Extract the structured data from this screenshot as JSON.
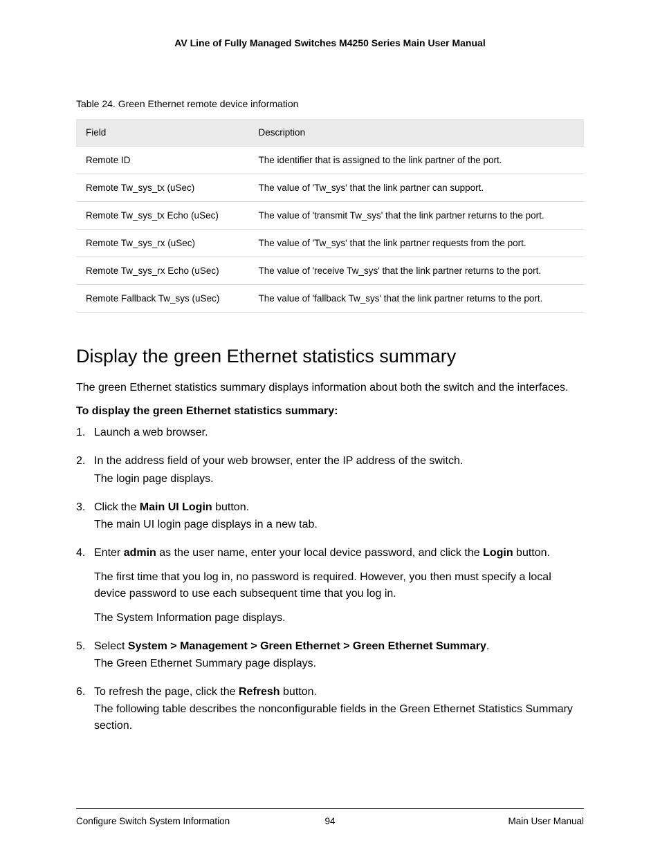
{
  "header": {
    "title": "AV Line of Fully Managed Switches M4250 Series Main User Manual"
  },
  "table": {
    "caption": "Table 24. Green Ethernet remote device information",
    "headers": {
      "col1": "Field",
      "col2": "Description"
    },
    "rows": [
      {
        "field": "Remote ID",
        "desc": "The identifier that is assigned to the link partner of the port."
      },
      {
        "field": "Remote Tw_sys_tx (uSec)",
        "desc": "The value of 'Tw_sys' that the link partner can support."
      },
      {
        "field": "Remote Tw_sys_tx Echo (uSec)",
        "desc": "The value of 'transmit Tw_sys' that the link partner returns to the port."
      },
      {
        "field": "Remote Tw_sys_rx (uSec)",
        "desc": "The value of 'Tw_sys' that the link partner requests from the port."
      },
      {
        "field": "Remote Tw_sys_rx Echo (uSec)",
        "desc": "The value of 'receive Tw_sys' that the link partner returns to the port."
      },
      {
        "field": "Remote Fallback Tw_sys (uSec)",
        "desc": "The value of 'fallback Tw_sys' that the link partner returns to the port."
      }
    ]
  },
  "section": {
    "heading": "Display the green Ethernet statistics summary",
    "intro": "The green Ethernet statistics summary displays information about both the switch and the interfaces.",
    "procedure_head": "To display the green Ethernet statistics summary:",
    "steps": {
      "s1": {
        "main": "Launch a web browser."
      },
      "s2": {
        "main": "In the address field of your web browser, enter the IP address of the switch.",
        "sub": "The login page displays."
      },
      "s3": {
        "pre": "Click the ",
        "bold": "Main UI Login",
        "post": " button.",
        "sub": "The main UI login page displays in a new tab."
      },
      "s4": {
        "pre": "Enter ",
        "bold1": "admin",
        "mid": " as the user name, enter your local device password, and click the ",
        "bold2": "Login",
        "post": " button.",
        "p1": "The first time that you log in, no password is required. However, you then must specify a local device password to use each subsequent time that you log in.",
        "p2": "The System Information page displays."
      },
      "s5": {
        "pre": "Select ",
        "bold": "System > Management > Green Ethernet > Green Ethernet Summary",
        "post": ".",
        "sub": "The Green Ethernet Summary page displays."
      },
      "s6": {
        "pre": "To refresh the page, click the ",
        "bold": "Refresh",
        "post": " button.",
        "sub": "The following table describes the nonconfigurable fields in the Green Ethernet Statistics Summary section."
      }
    }
  },
  "footer": {
    "left": "Configure Switch System Information",
    "center": "94",
    "right": "Main User Manual"
  }
}
